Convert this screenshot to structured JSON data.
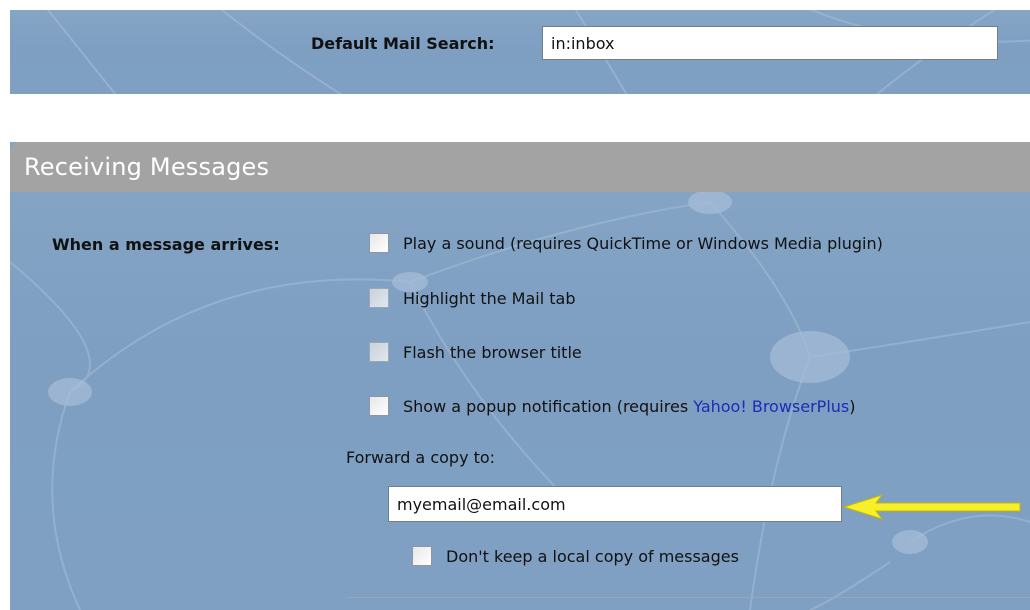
{
  "default_search": {
    "label": "Default Mail Search:",
    "value": "in:inbox"
  },
  "receiving": {
    "title": "Receiving Messages",
    "arrives_label": "When a message arrives:",
    "options": [
      {
        "label": "Play a sound (requires QuickTime or Windows Media plugin)",
        "checked": false
      },
      {
        "label": "Highlight the Mail tab",
        "checked": false
      },
      {
        "label": "Flash the browser title",
        "checked": false
      },
      {
        "label_prefix": "Show a popup notification (requires ",
        "link": "Yahoo! BrowserPlus",
        "label_suffix": ")",
        "checked": false
      }
    ],
    "forward_label": "Forward a copy to:",
    "forward_value": "myemail@email.com",
    "no_local_copy_label": "Don't keep a local copy of messages",
    "no_local_copy_checked": false
  },
  "colors": {
    "panel": "#7fa0c4",
    "header": "#a3a3a3",
    "link": "#1b2db5",
    "arrow": "#f5f02a"
  },
  "icons": {
    "arrow": "yellow-arrow-left-icon"
  }
}
